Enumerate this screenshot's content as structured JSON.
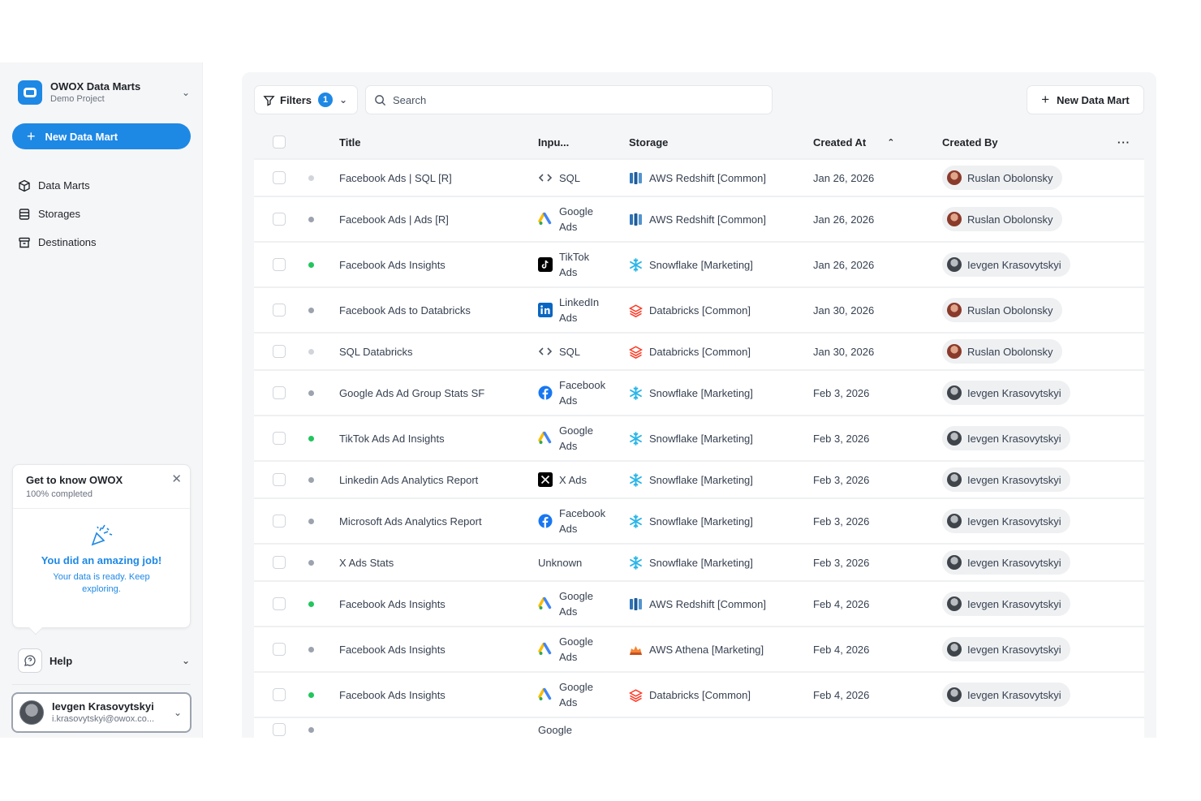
{
  "sidebar": {
    "project_name": "OWOX Data Marts",
    "project_sub": "Demo Project",
    "new_button": "New Data Mart",
    "nav": [
      {
        "label": "Data Marts",
        "icon": "cube-icon"
      },
      {
        "label": "Storages",
        "icon": "database-icon"
      },
      {
        "label": "Destinations",
        "icon": "archive-icon"
      }
    ],
    "onboarding": {
      "title": "Get to know OWOX",
      "progress": "100% completed",
      "headline": "You did an amazing job!",
      "message": "Your data is ready. Keep exploring."
    },
    "help_label": "Help",
    "user": {
      "name": "Ievgen Krasovytskyi",
      "email": "i.krasovytskyi@owox.co..."
    }
  },
  "toolbar": {
    "filters_label": "Filters",
    "filters_count": "1",
    "search_placeholder": "Search",
    "new_button": "New Data Mart"
  },
  "table": {
    "columns": {
      "title": "Title",
      "input": "Inpu...",
      "storage": "Storage",
      "created_at": "Created At",
      "created_by": "Created By",
      "more": "···"
    },
    "rows": [
      {
        "status": "gray-light",
        "title": "Facebook Ads | SQL [R]",
        "input_icon": "code-icon",
        "input": [
          "SQL"
        ],
        "storage_icon": "redshift",
        "storage": "AWS Redshift [Common]",
        "date": "Jan 26, 2026",
        "by": "Ruslan Obolonsky",
        "avatar": "r"
      },
      {
        "status": "gray",
        "title": "Facebook Ads | Ads [R]",
        "input_icon": "google-ads-icon",
        "input": [
          "Google",
          "Ads"
        ],
        "storage_icon": "redshift",
        "storage": "AWS Redshift [Common]",
        "date": "Jan 26, 2026",
        "by": "Ruslan Obolonsky",
        "avatar": "r"
      },
      {
        "status": "green",
        "title": "Facebook Ads Insights",
        "input_icon": "tiktok-icon",
        "input": [
          "TikTok",
          "Ads"
        ],
        "storage_icon": "snowflake",
        "storage": "Snowflake [Marketing]",
        "date": "Jan 26, 2026",
        "by": "Ievgen Krasovytskyi",
        "avatar": "i"
      },
      {
        "status": "gray",
        "title": "Facebook Ads to Databricks",
        "input_icon": "linkedin-icon",
        "input": [
          "LinkedIn",
          "Ads"
        ],
        "storage_icon": "databricks",
        "storage": "Databricks [Common]",
        "date": "Jan 30, 2026",
        "by": "Ruslan Obolonsky",
        "avatar": "r"
      },
      {
        "status": "gray-light",
        "title": "SQL Databricks",
        "input_icon": "code-icon",
        "input": [
          "SQL"
        ],
        "storage_icon": "databricks",
        "storage": "Databricks [Common]",
        "date": "Jan 30, 2026",
        "by": "Ruslan Obolonsky",
        "avatar": "r"
      },
      {
        "status": "gray",
        "title": "Google Ads Ad Group Stats SF",
        "input_icon": "facebook-icon",
        "input": [
          "Facebook",
          "Ads"
        ],
        "storage_icon": "snowflake",
        "storage": "Snowflake [Marketing]",
        "date": "Feb 3, 2026",
        "by": "Ievgen Krasovytskyi",
        "avatar": "i"
      },
      {
        "status": "green",
        "title": "TikTok Ads Ad Insights",
        "input_icon": "google-ads-icon",
        "input": [
          "Google",
          "Ads"
        ],
        "storage_icon": "snowflake",
        "storage": "Snowflake [Marketing]",
        "date": "Feb 3, 2026",
        "by": "Ievgen Krasovytskyi",
        "avatar": "i"
      },
      {
        "status": "gray",
        "title": "Linkedin Ads Analytics Report",
        "input_icon": "x-icon",
        "input": [
          "X Ads"
        ],
        "storage_icon": "snowflake",
        "storage": "Snowflake [Marketing]",
        "date": "Feb 3, 2026",
        "by": "Ievgen Krasovytskyi",
        "avatar": "i"
      },
      {
        "status": "gray",
        "title": "Microsoft Ads Analytics Report",
        "input_icon": "facebook-icon",
        "input": [
          "Facebook",
          "Ads"
        ],
        "storage_icon": "snowflake",
        "storage": "Snowflake [Marketing]",
        "date": "Feb 3, 2026",
        "by": "Ievgen Krasovytskyi",
        "avatar": "i"
      },
      {
        "status": "gray",
        "title": "X Ads Stats",
        "input_icon": "",
        "input": [
          "Unknown"
        ],
        "storage_icon": "snowflake",
        "storage": "Snowflake [Marketing]",
        "date": "Feb 3, 2026",
        "by": "Ievgen Krasovytskyi",
        "avatar": "i"
      },
      {
        "status": "green",
        "title": "Facebook Ads Insights",
        "input_icon": "google-ads-icon",
        "input": [
          "Google",
          "Ads"
        ],
        "storage_icon": "redshift",
        "storage": "AWS Redshift [Common]",
        "date": "Feb 4, 2026",
        "by": "Ievgen Krasovytskyi",
        "avatar": "i"
      },
      {
        "status": "gray",
        "title": "Facebook Ads Insights",
        "input_icon": "google-ads-icon",
        "input": [
          "Google",
          "Ads"
        ],
        "storage_icon": "athena",
        "storage": "AWS Athena [Marketing]",
        "date": "Feb 4, 2026",
        "by": "Ievgen Krasovytskyi",
        "avatar": "i"
      },
      {
        "status": "green",
        "title": "Facebook Ads Insights",
        "input_icon": "google-ads-icon",
        "input": [
          "Google",
          "Ads"
        ],
        "storage_icon": "databricks",
        "storage": "Databricks [Common]",
        "date": "Feb 4, 2026",
        "by": "Ievgen Krasovytskyi",
        "avatar": "i"
      },
      {
        "status": "gray",
        "title": "",
        "input_icon": "",
        "input": [
          "Google"
        ],
        "storage_icon": "",
        "storage": "",
        "date": "",
        "by": "",
        "avatar": ""
      }
    ]
  },
  "colors": {
    "accent": "#1e88e5",
    "green": "#22c55e",
    "gray": "#9ca3af",
    "gray_light": "#d1d5db"
  }
}
